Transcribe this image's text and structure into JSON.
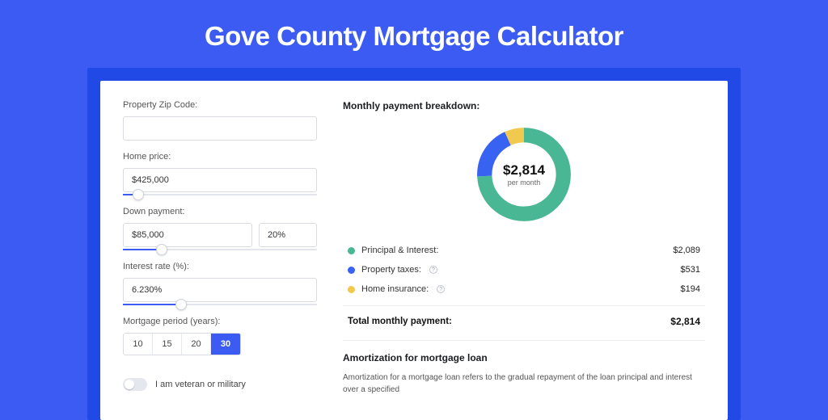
{
  "page": {
    "title": "Gove County Mortgage Calculator"
  },
  "colors": {
    "principal": "#49b793",
    "taxes": "#3862f1",
    "insurance": "#f1c94f"
  },
  "form": {
    "zip": {
      "label": "Property Zip Code:",
      "value": ""
    },
    "price": {
      "label": "Home price:",
      "value": "$425,000",
      "slider_pct": 8
    },
    "down": {
      "label": "Down payment:",
      "amount": "$85,000",
      "pct": "20%",
      "slider_pct": 20
    },
    "rate": {
      "label": "Interest rate (%):",
      "value": "6.230%",
      "slider_pct": 30
    },
    "period": {
      "label": "Mortgage period (years):",
      "options": [
        "10",
        "15",
        "20",
        "30"
      ],
      "active": "30"
    },
    "veteran": {
      "label": "I am veteran or military",
      "checked": false
    }
  },
  "breakdown": {
    "title": "Monthly payment breakdown:",
    "center_amount": "$2,814",
    "center_sub": "per month",
    "items": [
      {
        "key": "principal",
        "label": "Principal & Interest:",
        "value": "$2,089",
        "info": false
      },
      {
        "key": "taxes",
        "label": "Property taxes:",
        "value": "$531",
        "info": true
      },
      {
        "key": "insurance",
        "label": "Home insurance:",
        "value": "$194",
        "info": true
      }
    ],
    "total_label": "Total monthly payment:",
    "total_value": "$2,814"
  },
  "chart_data": {
    "type": "pie",
    "title": "Monthly payment breakdown",
    "series": [
      {
        "name": "Principal & Interest",
        "value": 2089
      },
      {
        "name": "Property taxes",
        "value": 531
      },
      {
        "name": "Home insurance",
        "value": 194
      }
    ],
    "total": 2814,
    "unit": "$ per month"
  },
  "amortization": {
    "title": "Amortization for mortgage loan",
    "text": "Amortization for a mortgage loan refers to the gradual repayment of the loan principal and interest over a specified"
  }
}
